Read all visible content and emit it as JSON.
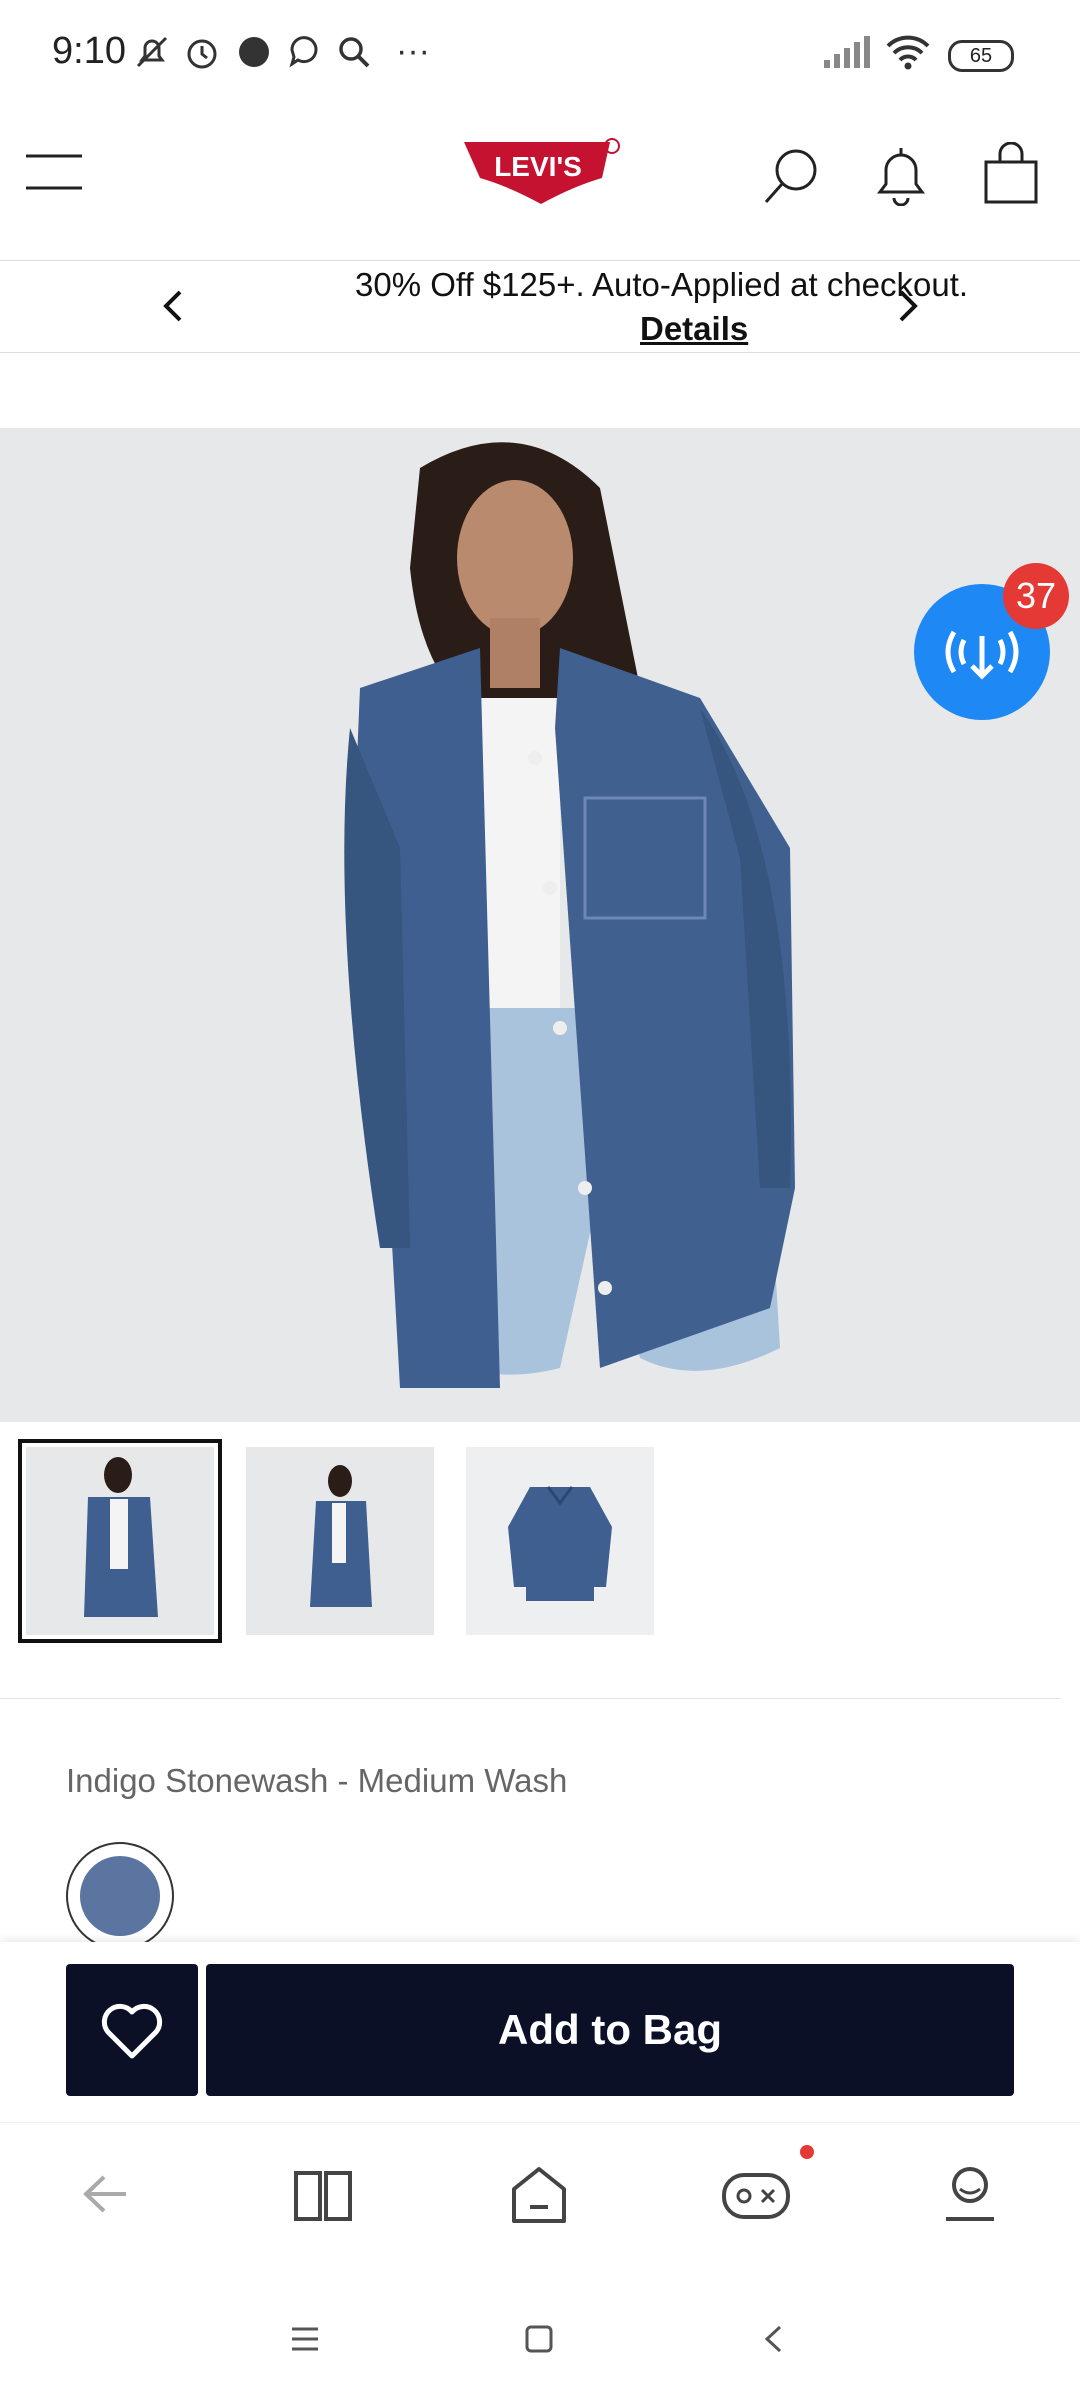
{
  "status_bar": {
    "time": "9:10",
    "battery": "65"
  },
  "header": {
    "logo_text": "Levi's"
  },
  "promo": {
    "text": "30% Off $125+. Auto-Applied at checkout.",
    "details_link": "Details"
  },
  "notification_badge": {
    "count": "37"
  },
  "product": {
    "color_name": "Indigo Stonewash - Medium Wash",
    "swatch_color": "#5b74a0"
  },
  "actions": {
    "add_to_bag": "Add to Bag"
  },
  "colors": {
    "brand_red": "#c41230",
    "button_dark": "#0b1026",
    "fab_blue": "#1e88f5",
    "badge_red": "#e53935"
  },
  "icons": [
    "menu-icon",
    "search-icon",
    "bell-icon",
    "bag-icon",
    "chevron-left-icon",
    "chevron-right-icon",
    "download-broadcast-icon",
    "heart-icon",
    "back-arrow-icon",
    "book-icon",
    "home-icon",
    "gamepad-icon",
    "profile-icon"
  ]
}
